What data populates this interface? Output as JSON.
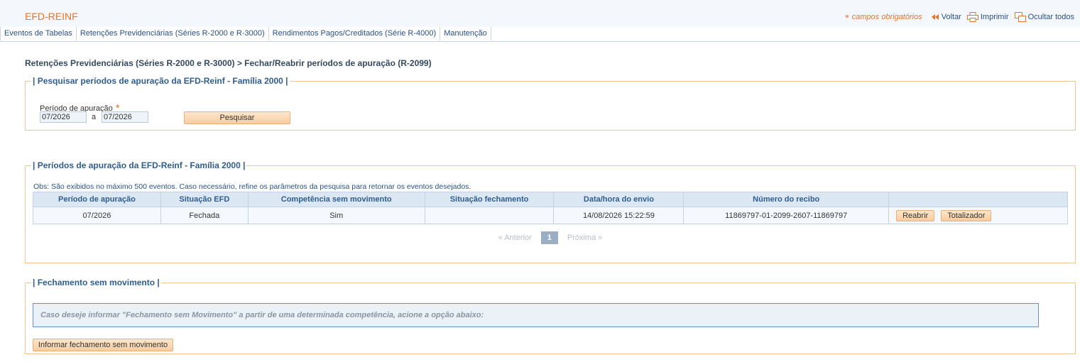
{
  "header": {
    "app_title": "EFD-REINF",
    "required_star": "*",
    "required_label": "campos obrigatórios",
    "voltar": "Voltar",
    "imprimir": "Imprimir",
    "ocultar": "Ocultar todos"
  },
  "menu": [
    "Eventos de Tabelas",
    "Retenções Previdenciárias (Séries R-2000 e R-3000)",
    "Rendimentos Pagos/Creditados (Série R-4000)",
    "Manutenção"
  ],
  "breadcrumb": "Retenções Previdenciárias (Séries R-2000 e R-3000) > Fechar/Reabrir períodos de apuração (R-2099)",
  "search": {
    "legend": "| Pesquisar períodos de apuração da EFD-Reinf - Família 2000 |",
    "period_label": "Período de apuração",
    "required_star": "*",
    "from": "07/2026",
    "sep": "a",
    "to": "07/2026",
    "button": "Pesquisar"
  },
  "results": {
    "legend": "| Períodos de apuração da EFD-Reinf - Família 2000 |",
    "obs": "Obs: São exibidos no máximo 500 eventos. Caso necessário, refine os parâmetros da pesquisa para retornar os eventos desejados.",
    "columns": [
      "Período de apuração",
      "Situação EFD",
      "Competência sem movimento",
      "Situação fechamento",
      "Data/hora do envio",
      "Número do recibo",
      ""
    ],
    "row": {
      "periodo": "07/2026",
      "situacao": "Fechada",
      "competencia": "Sim",
      "fechamento": "",
      "data_hora": "14/08/2026 15:22:59",
      "recibo": "11869797-01-2099-2607-11869797",
      "btn_reabrir": "Reabrir",
      "btn_totalizador": "Totalizador"
    },
    "pager": {
      "prev": "« Anterior",
      "current": "1",
      "next": "Próxima »"
    }
  },
  "fechamento": {
    "legend": "| Fechamento sem movimento |",
    "info": "Caso deseje informar \"Fechamento sem Movimento\" a partir de uma determinada competência, acione a opção abaixo:",
    "button": "Informar fechamento sem movimento"
  }
}
